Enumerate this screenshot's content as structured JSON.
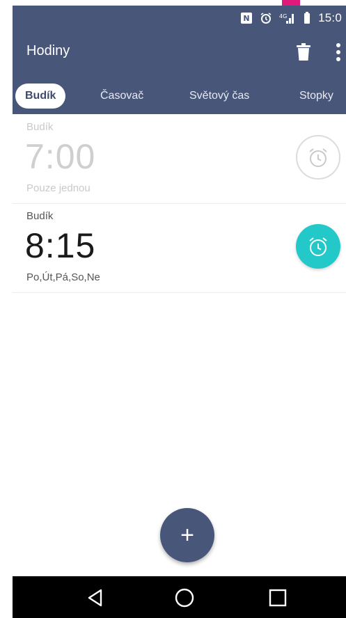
{
  "status_bar": {
    "time": "15:0",
    "icons": [
      "nfc-icon",
      "alarm-icon",
      "signal-icon",
      "battery-icon"
    ]
  },
  "app_bar": {
    "title": "Hodiny",
    "actions": [
      "trash-icon",
      "more-vert-icon"
    ]
  },
  "tabs": [
    {
      "label": "Budík",
      "active": true
    },
    {
      "label": "Časovač",
      "active": false
    },
    {
      "label": "Světový čas",
      "active": false
    },
    {
      "label": "Stopky",
      "active": false
    }
  ],
  "alarms": [
    {
      "label": "Budík",
      "time": "7:00",
      "repeat": "Pouze jednou",
      "enabled": false
    },
    {
      "label": "Budík",
      "time": "8:15",
      "repeat": "Po,Út,Pá,So,Ne",
      "enabled": true
    }
  ],
  "fab": {
    "label": "+"
  },
  "nav_bar": {
    "buttons": [
      "back-icon",
      "home-icon",
      "recent-apps-icon"
    ]
  },
  "colors": {
    "primary": "#475679",
    "accent": "#23c9c9",
    "nav": "#000000"
  }
}
